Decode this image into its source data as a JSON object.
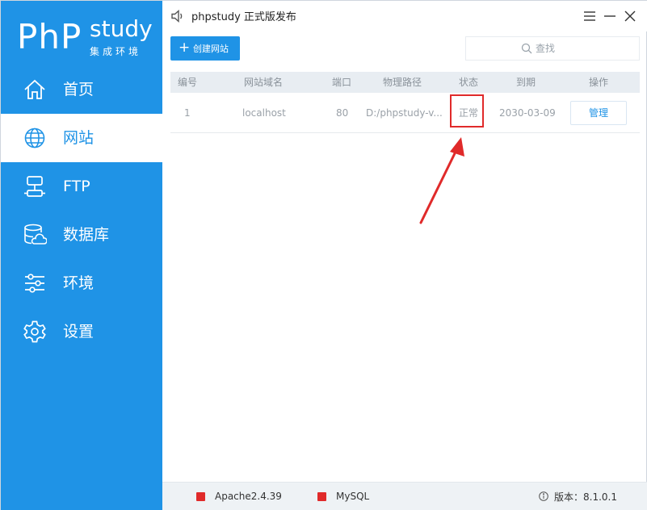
{
  "window": {
    "title": "phpstudy 正式版发布"
  },
  "logo": {
    "php": "PhP",
    "study": "study",
    "subtitle": "集成环境"
  },
  "sidebar": {
    "items": [
      {
        "label": "首页",
        "icon": "home-icon",
        "active": false
      },
      {
        "label": "网站",
        "icon": "globe-icon",
        "active": true
      },
      {
        "label": "FTP",
        "icon": "ftp-icon",
        "active": false
      },
      {
        "label": "数据库",
        "icon": "database-icon",
        "active": false
      },
      {
        "label": "环境",
        "icon": "sliders-icon",
        "active": false
      },
      {
        "label": "设置",
        "icon": "gear-icon",
        "active": false
      }
    ]
  },
  "toolbar": {
    "create_label": "创建网站",
    "create_icon": "plus-icon"
  },
  "search": {
    "placeholder": "查找"
  },
  "table": {
    "headers": [
      "编号",
      "网站域名",
      "端口",
      "物理路径",
      "状态",
      "到期",
      "操作"
    ],
    "rows": [
      {
        "id": "1",
        "domain": "localhost",
        "port": "80",
        "path": "D:/phpstudy-v...",
        "status": "正常",
        "expires": "2030-03-09",
        "action": "管理"
      }
    ]
  },
  "status": {
    "services": [
      {
        "name": "Apache2.4.39",
        "state_color": "#e02a2a"
      },
      {
        "name": "MySQL",
        "state_color": "#e02a2a"
      }
    ],
    "version": "版本：8.1.0.1"
  },
  "colors": {
    "accent": "#1f93e6",
    "annotation": "#e02a2a"
  }
}
